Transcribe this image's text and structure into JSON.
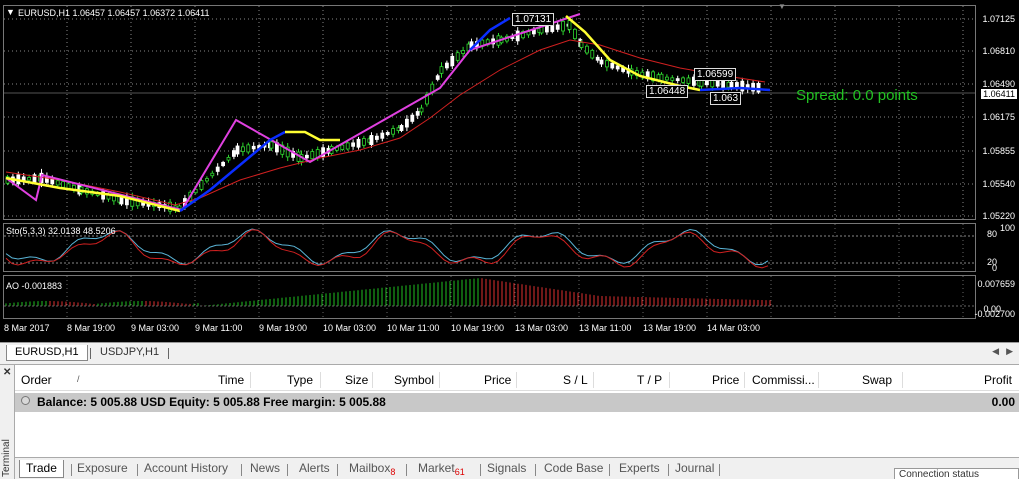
{
  "chart": {
    "main_label": "EURUSD,H1  1.06457 1.06457 1.06372 1.06411",
    "stoch_label": "Sto(5,3,3) 32.0138 48.5206",
    "ao_label": "AO -0.001883",
    "spread_text": "Spread: 0.0 points",
    "price_labels": [
      "1.07125",
      "1.06810",
      "1.06490",
      "1.06175",
      "1.05855",
      "1.05540",
      "1.05220"
    ],
    "current_price": "1.06411",
    "stoch_levels": [
      "80",
      "20",
      "0"
    ],
    "stoch_top": "100",
    "ao_labels": [
      "0.007659",
      "0.00",
      "-0.002700"
    ],
    "time_labels": [
      "8 Mar 2017",
      "8 Mar 19:00",
      "9 Mar 03:00",
      "9 Mar 11:00",
      "9 Mar 19:00",
      "10 Mar 03:00",
      "10 Mar 11:00",
      "10 Mar 19:00",
      "13 Mar 03:00",
      "13 Mar 11:00",
      "13 Mar 19:00",
      "14 Mar 03:00"
    ],
    "callouts": [
      "1.07131",
      "1.06599",
      "1.06448",
      "1.063"
    ],
    "colors": {
      "up_candle": "#2fd62f",
      "down_candle": "#ffffff",
      "zigzag": "#e040e0",
      "trend_up": "#0a2dff",
      "trend_down": "#ffff33",
      "ma": "#d02020",
      "ao_up": "#20c020",
      "ao_down": "#e03030",
      "spread": "#22c322"
    }
  },
  "chart_tabs": [
    "EURUSD,H1",
    "USDJPY,H1"
  ],
  "terminal": {
    "side_label": "Terminal",
    "columns": [
      "Order",
      "Time",
      "Type",
      "Size",
      "Symbol",
      "Price",
      "S / L",
      "T / P",
      "Price",
      "Commissi...",
      "Swap",
      "Profit"
    ],
    "balance_line": "Balance: 5 005.88 USD  Equity: 5 005.88  Free margin: 5 005.88",
    "profit": "0.00",
    "tabs": [
      {
        "label": "Trade",
        "badge": ""
      },
      {
        "label": "Exposure",
        "badge": ""
      },
      {
        "label": "Account History",
        "badge": ""
      },
      {
        "label": "News",
        "badge": ""
      },
      {
        "label": "Alerts",
        "badge": ""
      },
      {
        "label": "Mailbox",
        "badge": "8"
      },
      {
        "label": "Market",
        "badge": "61"
      },
      {
        "label": "Signals",
        "badge": ""
      },
      {
        "label": "Code Base",
        "badge": ""
      },
      {
        "label": "Experts",
        "badge": ""
      },
      {
        "label": "Journal",
        "badge": ""
      }
    ],
    "connection": "Connection status"
  }
}
